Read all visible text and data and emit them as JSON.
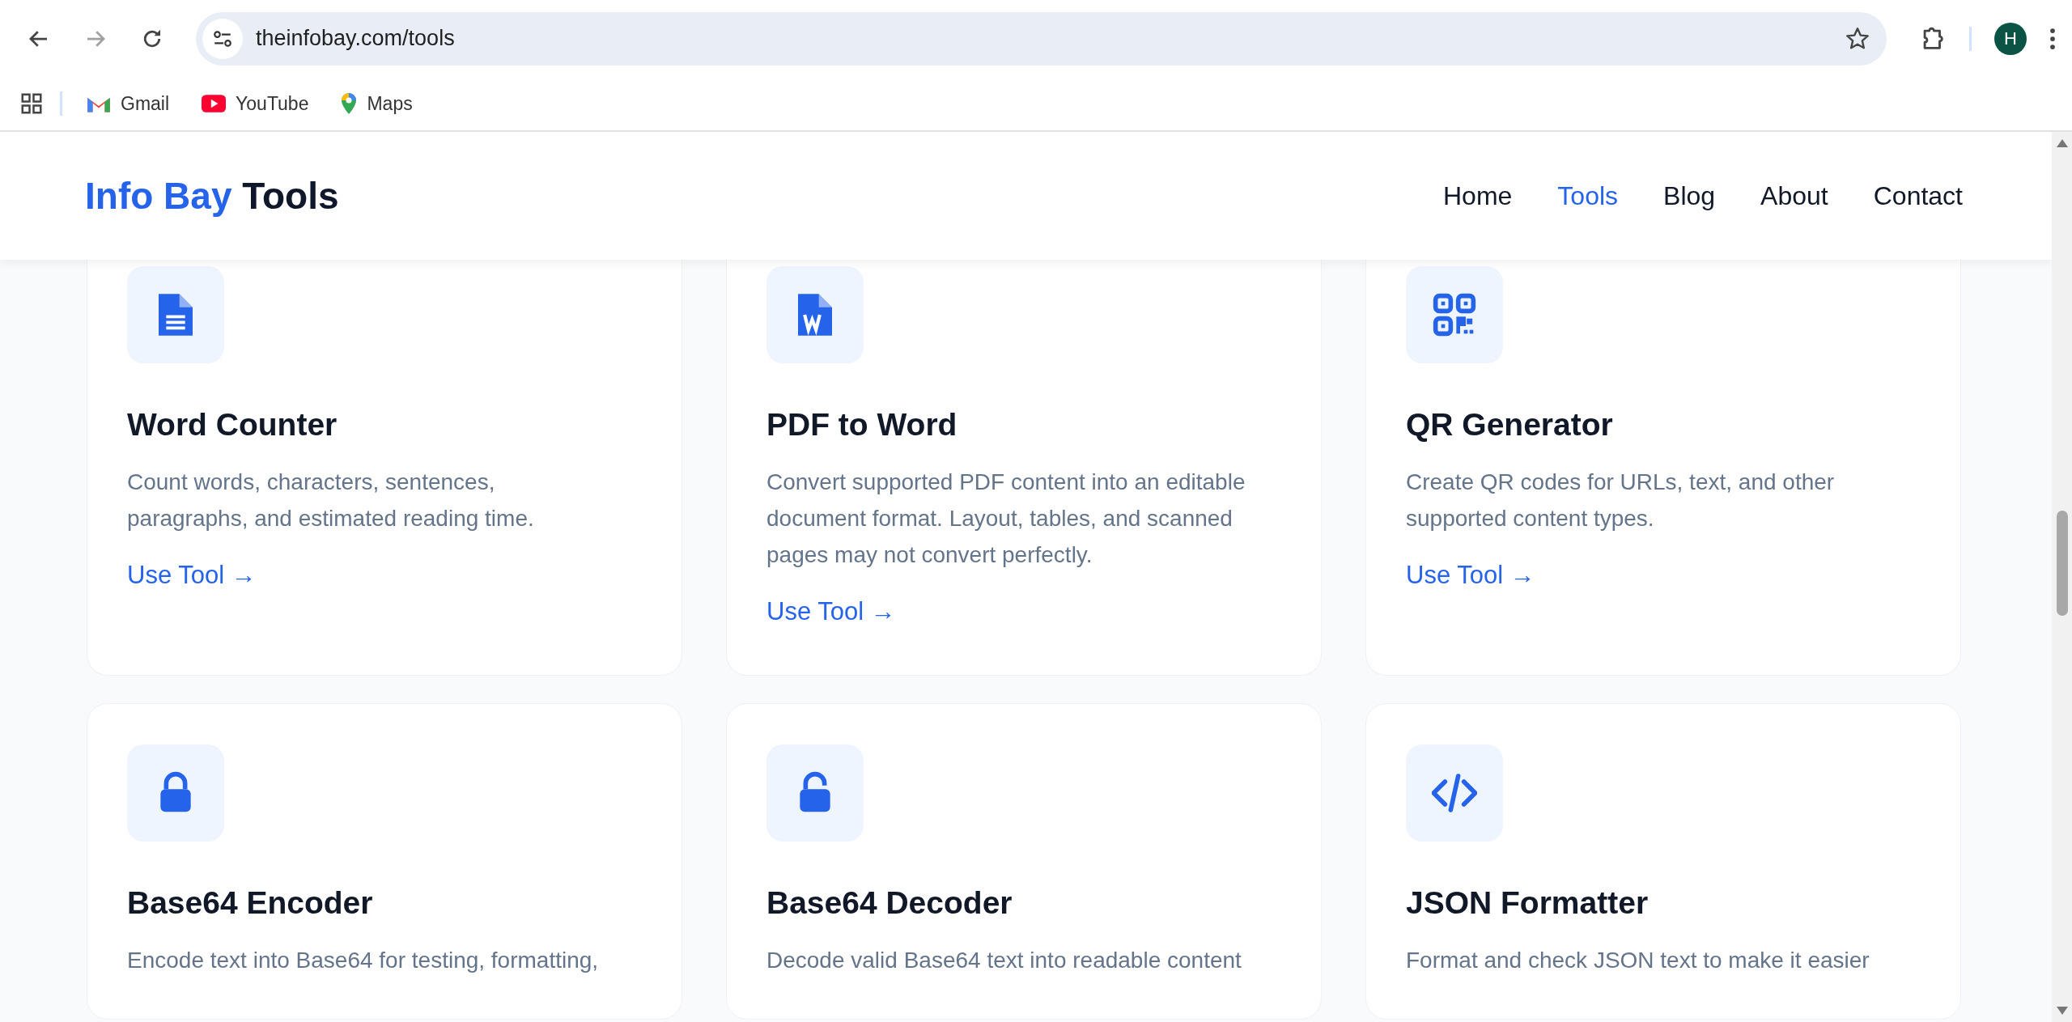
{
  "browser": {
    "nav_buttons": [
      {
        "kind": "back",
        "disabled": false
      },
      {
        "kind": "forward",
        "disabled": true
      },
      {
        "kind": "reload",
        "disabled": false
      }
    ],
    "url": "theinfobay.com/tools",
    "bookmarks": [
      {
        "kind": "gmail",
        "label": "Gmail"
      },
      {
        "kind": "youtube",
        "label": "YouTube"
      },
      {
        "kind": "maps",
        "label": "Maps"
      }
    ],
    "profile_initial": "H"
  },
  "site_header": {
    "logo": {
      "accent": "Info Bay",
      "rest": "Tools"
    },
    "nav": [
      {
        "label": "Home",
        "selected": false
      },
      {
        "label": "Tools",
        "selected": true
      },
      {
        "label": "Blog",
        "selected": false
      },
      {
        "label": "About",
        "selected": false
      },
      {
        "label": "Contact",
        "selected": false
      }
    ]
  },
  "tools": [
    {
      "kind": "document",
      "title": "Word Counter",
      "description": "Count words, characters, sentences, paragraphs, and estimated reading time.",
      "link": "Use Tool →"
    },
    {
      "kind": "word",
      "title": "PDF to Word",
      "description": "Convert supported PDF content into an editable document format. Layout, tables, and scanned pages may not convert perfectly.",
      "link": "Use Tool →"
    },
    {
      "kind": "qr",
      "title": "QR Generator",
      "description": "Create QR codes for URLs, text, and other supported content types.",
      "link": "Use Tool →"
    },
    {
      "kind": "lock",
      "title": "Base64 Encoder",
      "description": "Encode text into Base64 for testing, formatting,"
    },
    {
      "kind": "unlock",
      "title": "Base64 Decoder",
      "description": "Decode valid Base64 text into readable content"
    },
    {
      "kind": "code",
      "title": "JSON Formatter",
      "description": "Format and check JSON text to make it easier"
    }
  ]
}
